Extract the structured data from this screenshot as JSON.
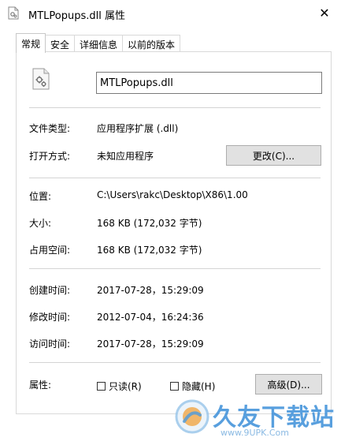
{
  "window": {
    "title": "MTLPopups.dll 属性",
    "close_glyph": "✕"
  },
  "tabs": [
    {
      "label": "常规",
      "active": true
    },
    {
      "label": "安全",
      "active": false
    },
    {
      "label": "详细信息",
      "active": false
    },
    {
      "label": "以前的版本",
      "active": false
    }
  ],
  "general": {
    "file_name": "MTLPopups.dll",
    "file_type_label": "文件类型:",
    "file_type_value": "应用程序扩展 (.dll)",
    "open_with_label": "打开方式:",
    "open_with_value": "未知应用程序",
    "change_button": "更改(C)...",
    "location_label": "位置:",
    "location_value": "C:\\Users\\rakc\\Desktop\\X86\\1.00",
    "size_label": "大小:",
    "size_value": "168 KB (172,032 字节)",
    "size_on_disk_label": "占用空间:",
    "size_on_disk_value": "168 KB (172,032 字节)",
    "created_label": "创建时间:",
    "created_value": "2017-07-28，15:29:09",
    "modified_label": "修改时间:",
    "modified_value": "2012-07-04，16:24:36",
    "accessed_label": "访问时间:",
    "accessed_value": "2017-07-28，15:29:09",
    "attributes_label": "属性:",
    "readonly_label": "只读(R)",
    "hidden_label": "隐藏(H)",
    "advanced_button": "高级(D)..."
  },
  "watermark": {
    "text": "久友下载站",
    "url": "www.9UPK.Com"
  },
  "icons": {
    "title": "dll-file-icon",
    "file": "dll-file-gear-icon",
    "watermark": "watermark-logo-icon"
  },
  "colors": {
    "button_bg": "#e1e1e1",
    "watermark_blue": "#3b8fd9"
  }
}
